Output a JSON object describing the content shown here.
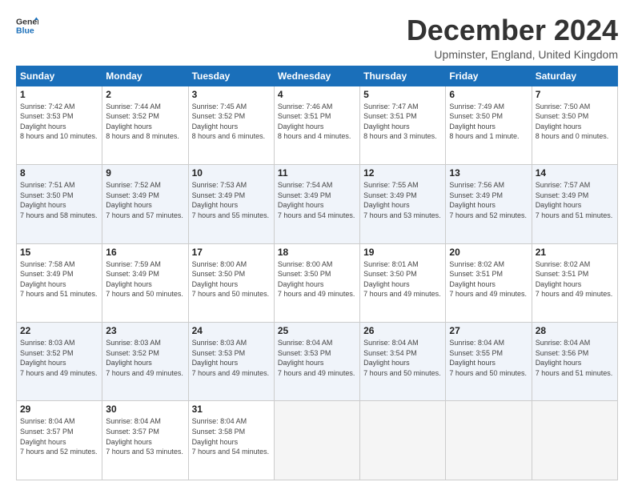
{
  "header": {
    "logo_line1": "General",
    "logo_line2": "Blue",
    "title": "December 2024",
    "subtitle": "Upminster, England, United Kingdom"
  },
  "days_of_week": [
    "Sunday",
    "Monday",
    "Tuesday",
    "Wednesday",
    "Thursday",
    "Friday",
    "Saturday"
  ],
  "weeks": [
    [
      {
        "day": 1,
        "sunrise": "7:42 AM",
        "sunset": "3:53 PM",
        "daylight": "8 hours and 10 minutes."
      },
      {
        "day": 2,
        "sunrise": "7:44 AM",
        "sunset": "3:52 PM",
        "daylight": "8 hours and 8 minutes."
      },
      {
        "day": 3,
        "sunrise": "7:45 AM",
        "sunset": "3:52 PM",
        "daylight": "8 hours and 6 minutes."
      },
      {
        "day": 4,
        "sunrise": "7:46 AM",
        "sunset": "3:51 PM",
        "daylight": "8 hours and 4 minutes."
      },
      {
        "day": 5,
        "sunrise": "7:47 AM",
        "sunset": "3:51 PM",
        "daylight": "8 hours and 3 minutes."
      },
      {
        "day": 6,
        "sunrise": "7:49 AM",
        "sunset": "3:50 PM",
        "daylight": "8 hours and 1 minute."
      },
      {
        "day": 7,
        "sunrise": "7:50 AM",
        "sunset": "3:50 PM",
        "daylight": "8 hours and 0 minutes."
      }
    ],
    [
      {
        "day": 8,
        "sunrise": "7:51 AM",
        "sunset": "3:50 PM",
        "daylight": "7 hours and 58 minutes."
      },
      {
        "day": 9,
        "sunrise": "7:52 AM",
        "sunset": "3:49 PM",
        "daylight": "7 hours and 57 minutes."
      },
      {
        "day": 10,
        "sunrise": "7:53 AM",
        "sunset": "3:49 PM",
        "daylight": "7 hours and 55 minutes."
      },
      {
        "day": 11,
        "sunrise": "7:54 AM",
        "sunset": "3:49 PM",
        "daylight": "7 hours and 54 minutes."
      },
      {
        "day": 12,
        "sunrise": "7:55 AM",
        "sunset": "3:49 PM",
        "daylight": "7 hours and 53 minutes."
      },
      {
        "day": 13,
        "sunrise": "7:56 AM",
        "sunset": "3:49 PM",
        "daylight": "7 hours and 52 minutes."
      },
      {
        "day": 14,
        "sunrise": "7:57 AM",
        "sunset": "3:49 PM",
        "daylight": "7 hours and 51 minutes."
      }
    ],
    [
      {
        "day": 15,
        "sunrise": "7:58 AM",
        "sunset": "3:49 PM",
        "daylight": "7 hours and 51 minutes."
      },
      {
        "day": 16,
        "sunrise": "7:59 AM",
        "sunset": "3:49 PM",
        "daylight": "7 hours and 50 minutes."
      },
      {
        "day": 17,
        "sunrise": "8:00 AM",
        "sunset": "3:50 PM",
        "daylight": "7 hours and 50 minutes."
      },
      {
        "day": 18,
        "sunrise": "8:00 AM",
        "sunset": "3:50 PM",
        "daylight": "7 hours and 49 minutes."
      },
      {
        "day": 19,
        "sunrise": "8:01 AM",
        "sunset": "3:50 PM",
        "daylight": "7 hours and 49 minutes."
      },
      {
        "day": 20,
        "sunrise": "8:02 AM",
        "sunset": "3:51 PM",
        "daylight": "7 hours and 49 minutes."
      },
      {
        "day": 21,
        "sunrise": "8:02 AM",
        "sunset": "3:51 PM",
        "daylight": "7 hours and 49 minutes."
      }
    ],
    [
      {
        "day": 22,
        "sunrise": "8:03 AM",
        "sunset": "3:52 PM",
        "daylight": "7 hours and 49 minutes."
      },
      {
        "day": 23,
        "sunrise": "8:03 AM",
        "sunset": "3:52 PM",
        "daylight": "7 hours and 49 minutes."
      },
      {
        "day": 24,
        "sunrise": "8:03 AM",
        "sunset": "3:53 PM",
        "daylight": "7 hours and 49 minutes."
      },
      {
        "day": 25,
        "sunrise": "8:04 AM",
        "sunset": "3:53 PM",
        "daylight": "7 hours and 49 minutes."
      },
      {
        "day": 26,
        "sunrise": "8:04 AM",
        "sunset": "3:54 PM",
        "daylight": "7 hours and 50 minutes."
      },
      {
        "day": 27,
        "sunrise": "8:04 AM",
        "sunset": "3:55 PM",
        "daylight": "7 hours and 50 minutes."
      },
      {
        "day": 28,
        "sunrise": "8:04 AM",
        "sunset": "3:56 PM",
        "daylight": "7 hours and 51 minutes."
      }
    ],
    [
      {
        "day": 29,
        "sunrise": "8:04 AM",
        "sunset": "3:57 PM",
        "daylight": "7 hours and 52 minutes."
      },
      {
        "day": 30,
        "sunrise": "8:04 AM",
        "sunset": "3:57 PM",
        "daylight": "7 hours and 53 minutes."
      },
      {
        "day": 31,
        "sunrise": "8:04 AM",
        "sunset": "3:58 PM",
        "daylight": "7 hours and 54 minutes."
      },
      null,
      null,
      null,
      null
    ]
  ]
}
